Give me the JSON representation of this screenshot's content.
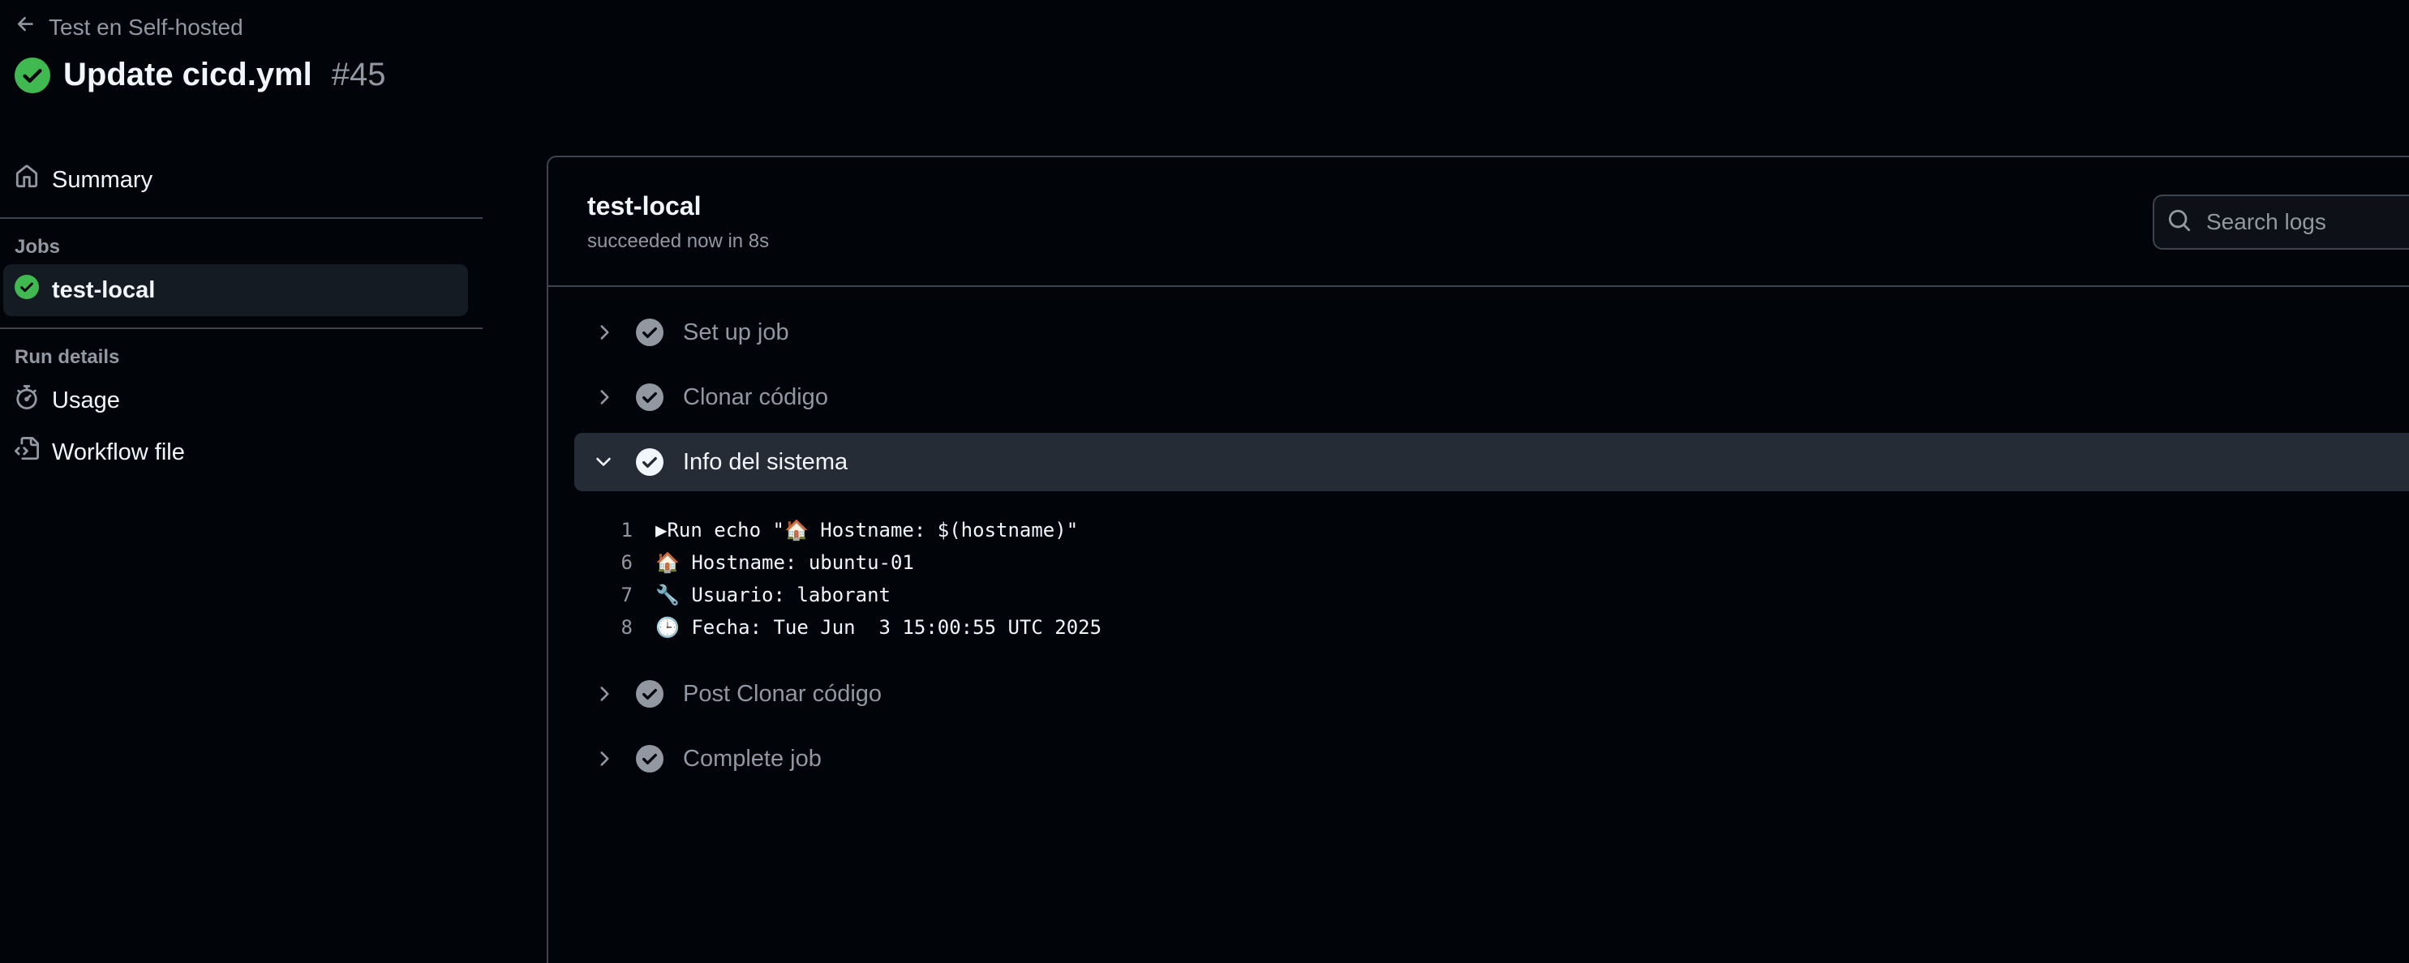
{
  "header": {
    "back_label": "Test en Self-hosted",
    "title": "Update cicd.yml",
    "run_number": "#45"
  },
  "sidebar": {
    "summary_label": "Summary",
    "jobs_heading": "Jobs",
    "jobs": [
      {
        "label": "test-local",
        "status": "success"
      }
    ],
    "run_details_heading": "Run details",
    "usage_label": "Usage",
    "workflow_file_label": "Workflow file"
  },
  "job": {
    "title": "test-local",
    "status_text": "succeeded now in 8s",
    "search_placeholder": "Search logs"
  },
  "steps": [
    {
      "label": "Set up job",
      "expanded": false
    },
    {
      "label": "Clonar código",
      "expanded": false
    },
    {
      "label": "Info del sistema",
      "expanded": true
    },
    {
      "label": "Post Clonar código",
      "expanded": false
    },
    {
      "label": "Complete job",
      "expanded": false
    }
  ],
  "log_lines": [
    {
      "num": "1",
      "text": "▶Run echo \"🏠 Hostname: $(hostname)\""
    },
    {
      "num": "6",
      "text": "🏠 Hostname: ubuntu-01"
    },
    {
      "num": "7",
      "text": "🔧 Usuario: laborant"
    },
    {
      "num": "8",
      "text": "🕒 Fecha: Tue Jun  3 15:00:55 UTC 2025"
    }
  ],
  "colors": {
    "success": "#3fb950",
    "step_check": "#9198a1",
    "background": "#010409",
    "expanded_row": "#262c36"
  },
  "icons": {
    "back": "arrow-left-icon",
    "status": "check-circle-fill-icon",
    "summary": "home-icon",
    "usage": "stopwatch-icon",
    "workflow": "file-code-icon",
    "search": "search-icon",
    "collapsed": "chevron-right-icon",
    "expanded": "chevron-down-icon"
  }
}
